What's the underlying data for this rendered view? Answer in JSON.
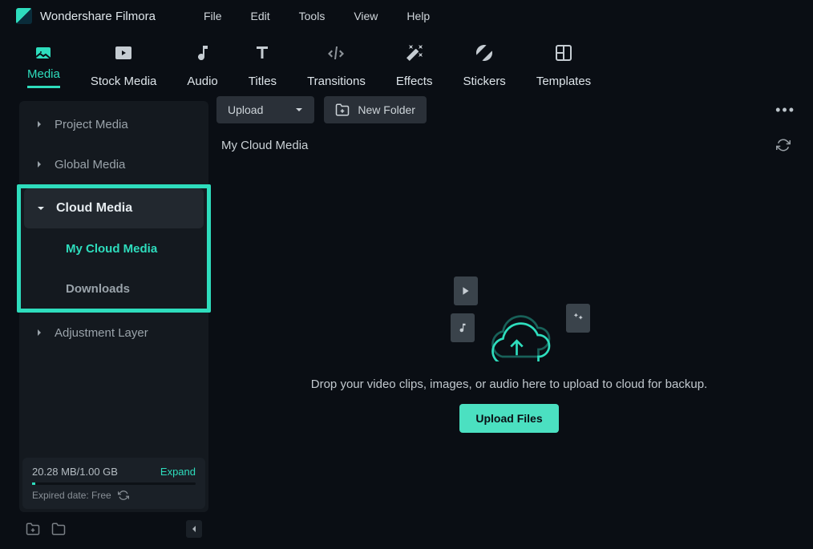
{
  "app": {
    "title": "Wondershare Filmora"
  },
  "menu": [
    "File",
    "Edit",
    "Tools",
    "View",
    "Help"
  ],
  "tabs": [
    {
      "label": "Media",
      "active": true
    },
    {
      "label": "Stock Media"
    },
    {
      "label": "Audio"
    },
    {
      "label": "Titles"
    },
    {
      "label": "Transitions"
    },
    {
      "label": "Effects"
    },
    {
      "label": "Stickers"
    },
    {
      "label": "Templates"
    }
  ],
  "sidebar": {
    "project_media": "Project Media",
    "global_media": "Global Media",
    "cloud_media": "Cloud Media",
    "my_cloud": "My Cloud Media",
    "downloads": "Downloads",
    "adjustment": "Adjustment Layer"
  },
  "storage": {
    "used": "20.28 MB/1.00 GB",
    "expand": "Expand",
    "expired": "Expired date: Free"
  },
  "toolbar": {
    "upload": "Upload",
    "new_folder": "New Folder"
  },
  "content": {
    "heading": "My Cloud Media",
    "drop_text": "Drop your video clips, images, or audio here to upload to cloud for backup.",
    "upload_button": "Upload Files"
  }
}
